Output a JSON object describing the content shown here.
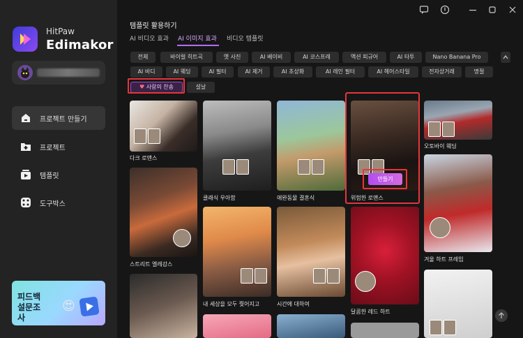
{
  "brand": {
    "small": "HitPaw",
    "big": "Edimakor"
  },
  "nav": [
    {
      "label": "프로젝트 만들기",
      "icon": "home-icon",
      "active": true
    },
    {
      "label": "프로젝트",
      "icon": "folder-icon",
      "active": false
    },
    {
      "label": "템플릿",
      "icon": "template-icon",
      "active": false
    },
    {
      "label": "도구박스",
      "icon": "toolbox-icon",
      "active": false
    }
  ],
  "promo": {
    "text": "피드백 설문조사"
  },
  "main": {
    "title": "템플릿 활용하기",
    "tabs": [
      {
        "label": "AI 비디오 효과",
        "active": false
      },
      {
        "label": "AI 이미지 효과",
        "active": true
      },
      {
        "label": "비디오 템플릿",
        "active": false
      }
    ]
  },
  "chips": [
    "전체",
    "바이럴 히트곡",
    "옛 사진",
    "AI 베이비",
    "AI 코스프레",
    "액션 피규어",
    "AI 타투",
    "Nano Banana Pro",
    "AI 바디",
    "AI 웨딩",
    "AI 필터",
    "AI 제거",
    "AI 초상화",
    "AI 레인 필터",
    "AI 헤어스타일",
    "전자상거래",
    "명절",
    "사랑의 찬송",
    "설날"
  ],
  "active_chip": "사랑의 찬송",
  "cards": [
    {
      "label": "다크 로맨스"
    },
    {
      "label": "스트리트 엘레강스"
    },
    {
      "label": "클래식 우아함"
    },
    {
      "label": "내 세상을 모두 찢어지고"
    },
    {
      "label": "애완동물 결혼식"
    },
    {
      "label": "시간에 대하여"
    },
    {
      "label": "위험한 로맨스"
    },
    {
      "label": "달콤한 레드 하트"
    },
    {
      "label": "오토바이 웨딩"
    },
    {
      "label": "겨울 하트 프레임"
    }
  ],
  "make_button": "만들기",
  "colors": {
    "accent": "#b46cff",
    "highlight": "#e8353b",
    "sidebar": "#232323",
    "background": "#161616"
  }
}
